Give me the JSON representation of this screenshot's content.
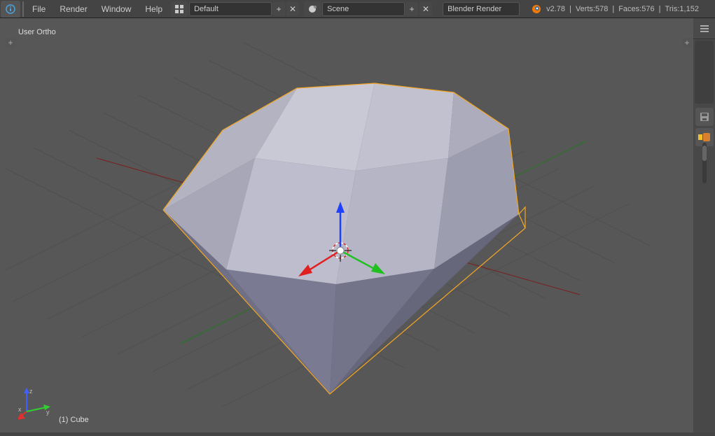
{
  "menus": {
    "file": "File",
    "render": "Render",
    "window": "Window",
    "help": "Help"
  },
  "layout_name": "Default",
  "scene_name": "Scene",
  "engine": "Blender Render",
  "version": "v2.78",
  "stats": {
    "verts": "Verts:578",
    "faces": "Faces:576",
    "tris": "Tris:1,152"
  },
  "view_label": "User Ortho",
  "object_label": "(1) Cube",
  "axis": {
    "x": "x",
    "y": "y",
    "z": "z"
  }
}
